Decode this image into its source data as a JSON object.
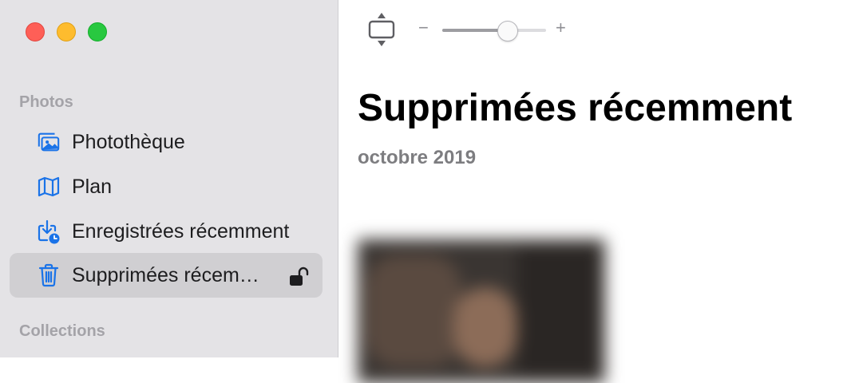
{
  "sidebar": {
    "sections": [
      {
        "title": "Photos",
        "items": [
          {
            "label": "Photothèque",
            "icon": "photo-library-icon"
          },
          {
            "label": "Plan",
            "icon": "map-icon"
          },
          {
            "label": "Enregistrées récemment",
            "icon": "download-clock-icon"
          },
          {
            "label": "Supprimées récem…",
            "icon": "trash-icon",
            "selected": true,
            "badge_icon": "unlocked-lock-icon"
          }
        ]
      },
      {
        "title": "Collections",
        "items": []
      }
    ]
  },
  "toolbar": {
    "zoom_minus": "−",
    "zoom_plus": "+",
    "zoom_level": 0.62
  },
  "main": {
    "title": "Supprimées récemment",
    "date_heading": "octobre 2019"
  },
  "colors": {
    "accent": "#1a73e8",
    "sidebar_bg": "#e4e3e6",
    "selected_bg": "#d0cfd2"
  }
}
